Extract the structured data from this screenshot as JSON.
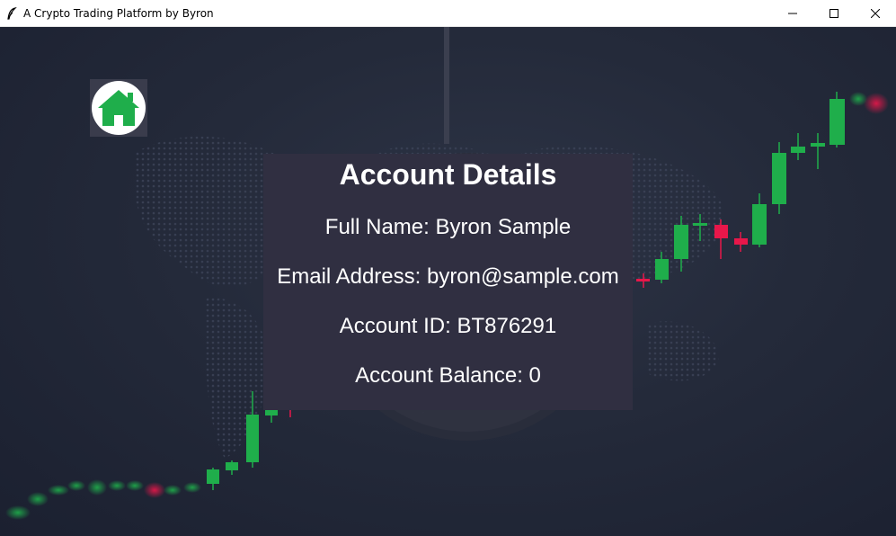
{
  "window": {
    "title": "A Crypto Trading Platform by Byron",
    "icons": {
      "app": "feather-icon",
      "minimize": "minimize-icon",
      "maximize": "maximize-icon",
      "close": "close-icon"
    }
  },
  "home": {
    "icon": "home-icon",
    "accent": "#1fae4b"
  },
  "account": {
    "title": "Account Details",
    "full_name": "Full Name: Byron Sample",
    "email": "Email Address: byron@sample.com",
    "account_id": "Account ID: BT876291",
    "balance": "Account Balance: 0"
  },
  "colors": {
    "panel": "#302f41",
    "up_candle": "#1fae4b",
    "down_candle": "#e8174a",
    "background": "#242a3a"
  }
}
